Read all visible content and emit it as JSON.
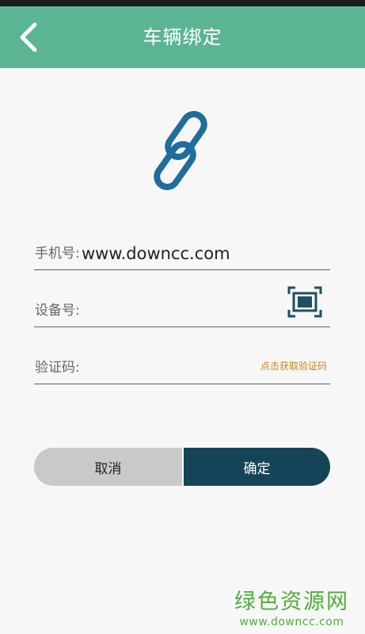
{
  "header": {
    "title": "车辆绑定"
  },
  "form": {
    "phone": {
      "label": "手机号:",
      "value": "www.downcc.com"
    },
    "device": {
      "label": "设备号:"
    },
    "code": {
      "label": "验证码:",
      "get_code_label": "点击获取验证码"
    }
  },
  "buttons": {
    "cancel": "取消",
    "confirm": "确定"
  },
  "watermark": {
    "title": "绿色资源网",
    "url": "www.downcc.com"
  },
  "colors": {
    "header_bg": "#5bb592",
    "accent_dark": "#154458",
    "link_icon": "#1f6d9b",
    "get_code_text": "#c7861e",
    "watermark": "#4fae3c"
  },
  "icons": [
    "back-arrow-icon",
    "chain-link-icon",
    "scan-frame-icon"
  ]
}
